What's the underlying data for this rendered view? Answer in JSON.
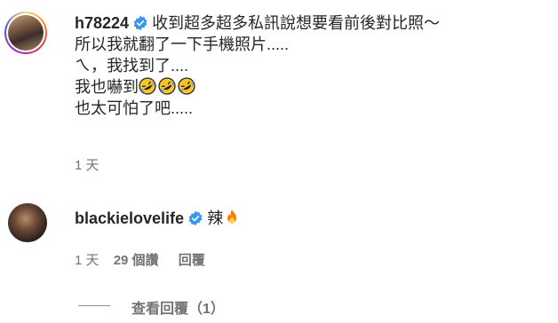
{
  "comments": [
    {
      "username": "h78224",
      "lines": [
        "收到超多超多私訊說想要看前後對比照～",
        "所以我就翻了一下手機照片.....",
        "ㄟ，我找到了....",
        "我也嚇到",
        "也太可怕了吧....."
      ],
      "time": "1 天"
    },
    {
      "username": "blackielovelife",
      "text": "辣",
      "time": "1 天",
      "likes": "29 個讚",
      "reply_label": "回覆"
    }
  ],
  "view_replies": "查看回覆（1）",
  "icons": {
    "verified": "verified-badge-icon",
    "laugh": "rolling-on-floor-laughing-icon",
    "fire": "fire-icon"
  },
  "colors": {
    "verified_blue": "#3797f0",
    "meta_gray": "#737373"
  }
}
